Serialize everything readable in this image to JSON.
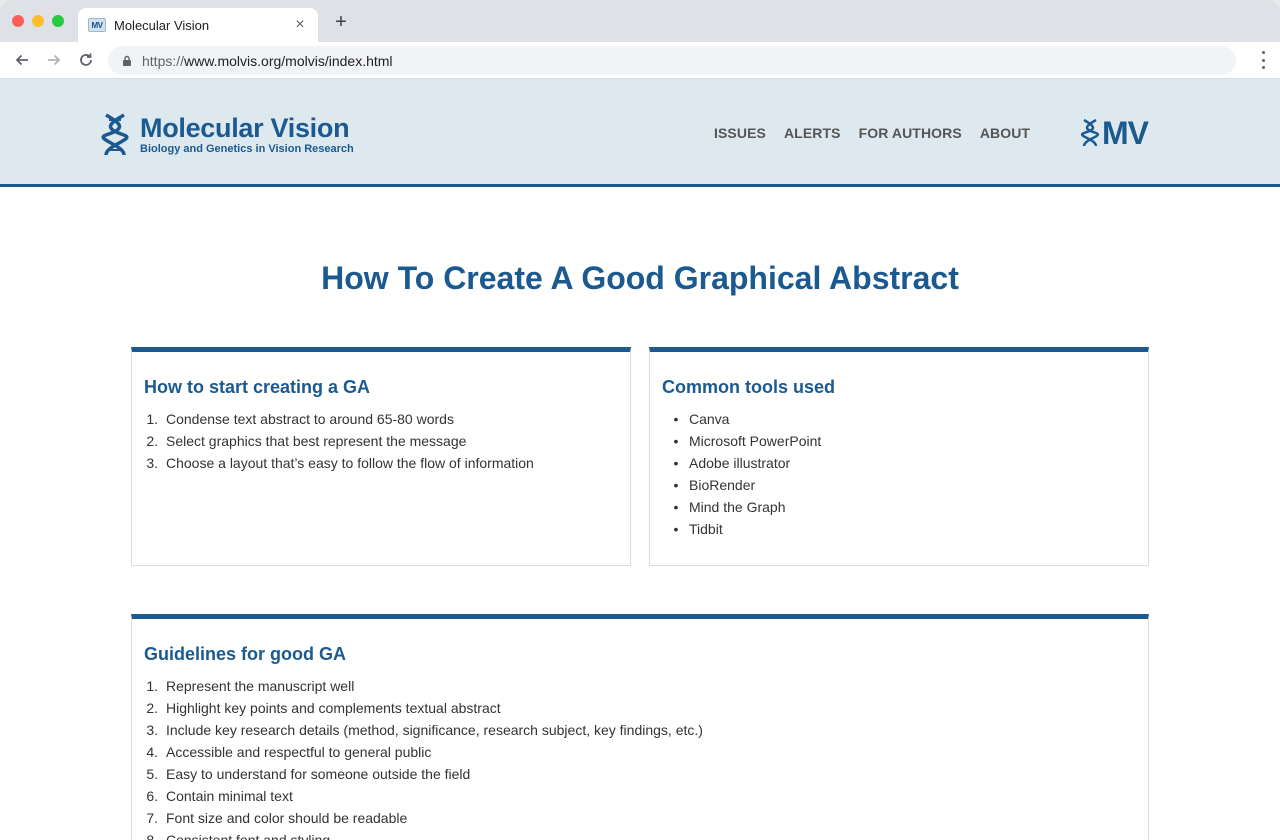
{
  "browser": {
    "tab_title": "Molecular Vision",
    "tab_favicon_text": "MV",
    "url_scheme": "https://",
    "url_rest": "www.molvis.org/molvis/index.html"
  },
  "site": {
    "logo_title": "Molecular Vision",
    "logo_subtitle": "Biology and Genetics in Vision Research",
    "nav": [
      "ISSUES",
      "ALERTS",
      "FOR AUTHORS",
      "ABOUT"
    ],
    "mv_logo": "MV",
    "brand_color": "#1b5a90",
    "header_bg": "#dde9ef"
  },
  "page": {
    "title": "How To Create A Good Graphical Abstract"
  },
  "start_card": {
    "title": "How to start creating a GA",
    "items": [
      "Condense text abstract to around 65-80 words",
      "Select graphics that best represent the message",
      "Choose a layout that’s easy to follow the flow of information"
    ]
  },
  "tools_card": {
    "title": "Common tools used",
    "items": [
      "Canva",
      "Microsoft PowerPoint",
      "Adobe illustrator",
      "BioRender",
      "Mind the Graph",
      "Tidbit"
    ]
  },
  "guide_card": {
    "title": "Guidelines for good GA",
    "items": [
      "Represent the manuscript well",
      "Highlight key points and complements textual abstract",
      "Include key research details (method, significance, research subject, key findings, etc.)",
      "Accessible and respectful to general public",
      "Easy to understand for someone outside the field",
      "Contain minimal text",
      "Font size and color should be readable",
      "Consistent font and styling"
    ]
  }
}
